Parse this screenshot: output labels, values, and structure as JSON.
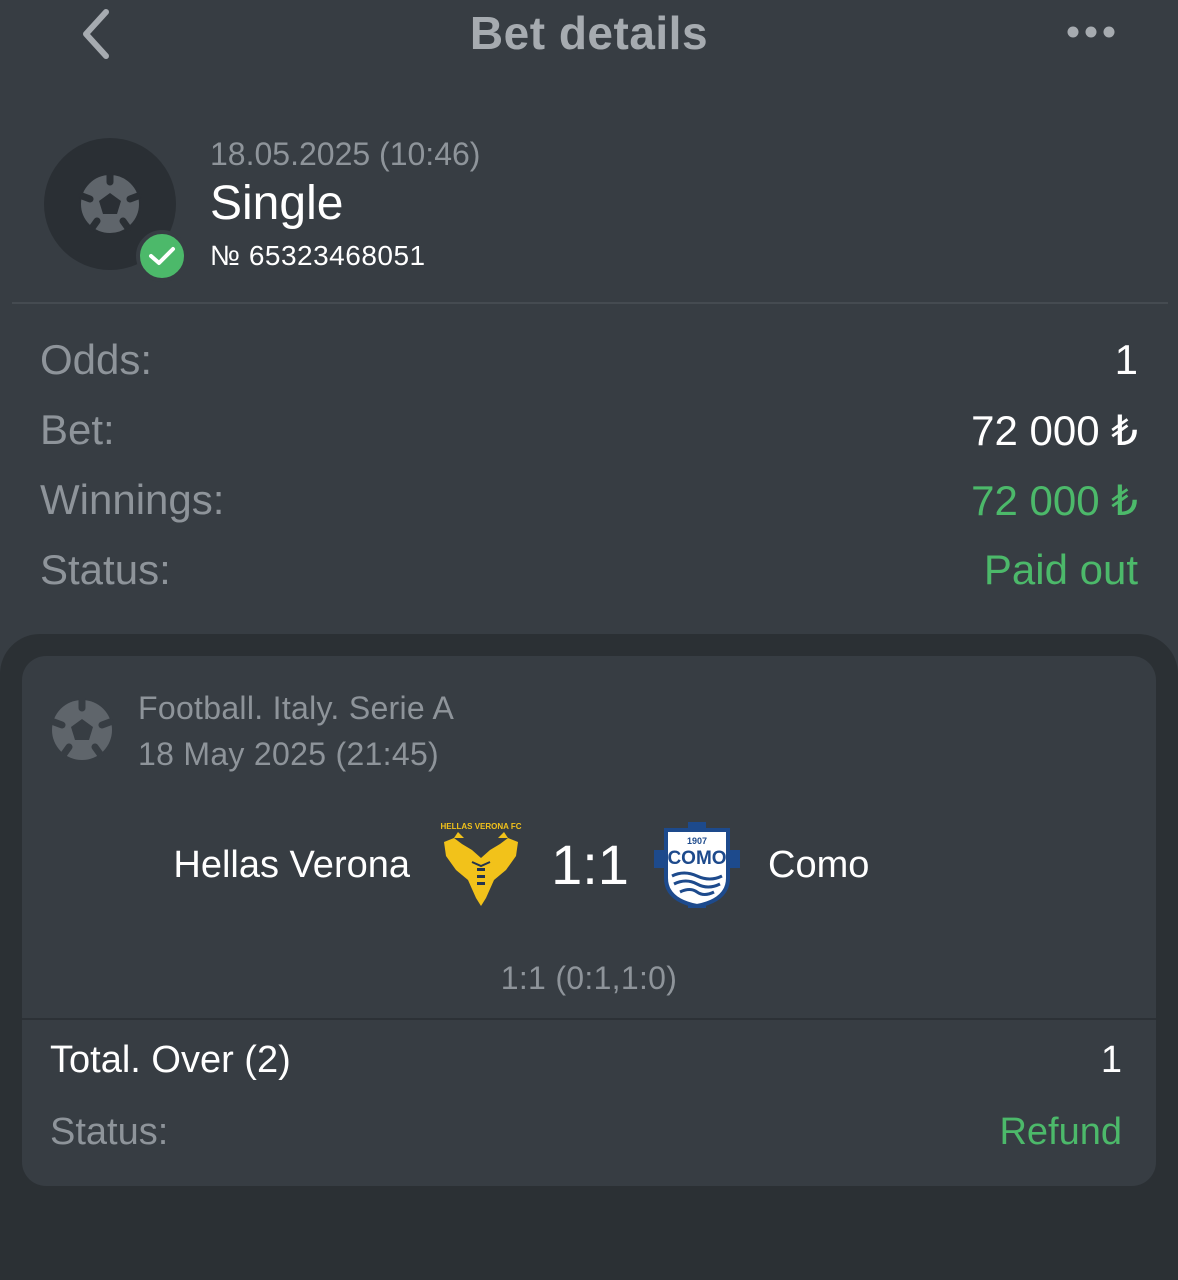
{
  "header": {
    "title": "Bet details"
  },
  "bet": {
    "datetime": "18.05.2025 (10:46)",
    "type": "Single",
    "number": "№ 65323468051",
    "status_icon": "check-icon"
  },
  "details": {
    "odds_label": "Odds:",
    "odds_value": "1",
    "bet_label": "Bet:",
    "bet_value": "72 000 ₺",
    "winnings_label": "Winnings:",
    "winnings_value": "72 000 ₺",
    "status_label": "Status:",
    "status_value": "Paid out"
  },
  "event": {
    "league": "Football. Italy. Serie A",
    "date": "18 May 2025 (21:45)",
    "home_team": "Hellas Verona",
    "home_logo_text": "HELLAS VERONA FC",
    "away_team": "Como",
    "away_logo_text": "COMO",
    "away_logo_year": "1907",
    "score": "1:1",
    "score_detail": "1:1 (0:1,1:0)",
    "market": "Total. Over (2)",
    "market_odds": "1",
    "status_label": "Status:",
    "status_value": "Refund"
  },
  "colors": {
    "background": "#373d43",
    "card_frame": "#2b3034",
    "accent_green": "#4cb96a",
    "muted_text": "#8e949a"
  }
}
